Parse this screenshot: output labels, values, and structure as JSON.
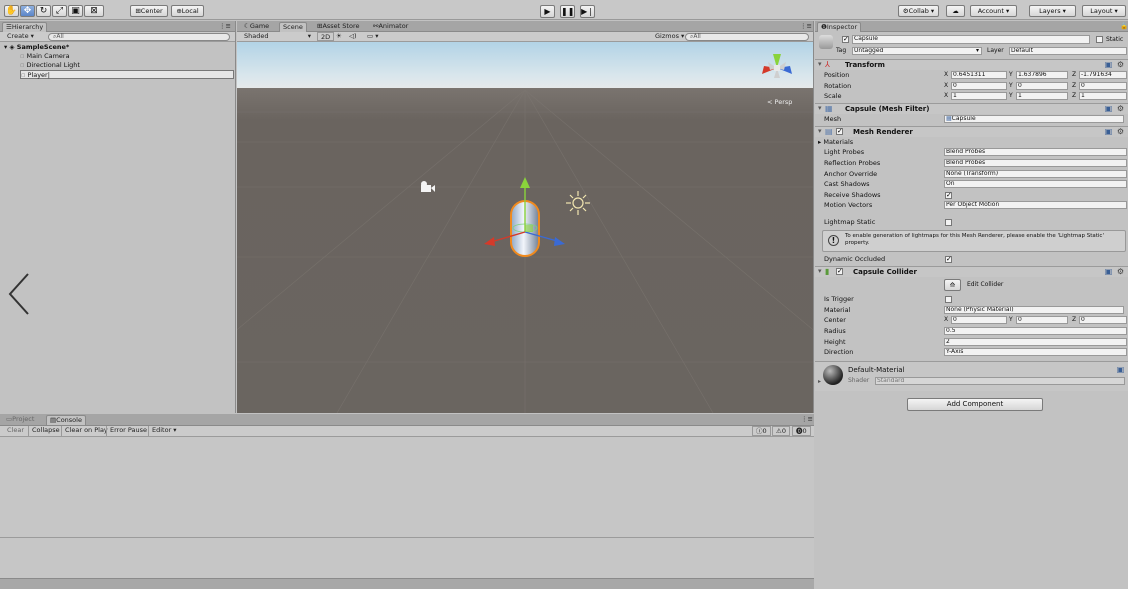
{
  "toolbar": {
    "tools": [
      "hand-tool",
      "move-tool",
      "rotate-tool",
      "scale-tool",
      "rect-tool",
      "transform-tool"
    ],
    "pivot_label": "Center",
    "space_label": "Local",
    "collab_label": "Collab ▾",
    "account_label": "Account ▾",
    "layers_label": "Layers ▾",
    "layout_label": "Layout ▾"
  },
  "hierarchy": {
    "tab_label": "Hierarchy",
    "create_label": "Create ▾",
    "search_placeholder": "All",
    "scene_name": "SampleScene*",
    "items": [
      "Main Camera",
      "Directional Light",
      "Player"
    ]
  },
  "scene": {
    "tabs": [
      "Game",
      "Scene",
      "Asset Store",
      "Animator"
    ],
    "shading": "Shaded",
    "mode_2d": "2D",
    "gizmos_label": "Gizmos ▾",
    "search_placeholder": "All",
    "persp_label": "< Persp"
  },
  "inspector": {
    "tab_label": "Inspector",
    "object_name": "Capsule",
    "static_label": "Static",
    "tag_label": "Tag",
    "tag_value": "Untagged",
    "layer_label": "Layer",
    "layer_value": "Default",
    "transform": {
      "title": "Transform",
      "position_label": "Position",
      "position": {
        "x": "0.6451311",
        "y": "1.637896",
        "z": "-1.791634"
      },
      "rotation_label": "Rotation",
      "rotation": {
        "x": "0",
        "y": "0",
        "z": "0"
      },
      "scale_label": "Scale",
      "scale": {
        "x": "1",
        "y": "1",
        "z": "1"
      }
    },
    "mesh_filter": {
      "title": "Capsule (Mesh Filter)",
      "mesh_label": "Mesh",
      "mesh_value": "Capsule"
    },
    "mesh_renderer": {
      "title": "Mesh Renderer",
      "materials_label": "Materials",
      "light_probes_label": "Light Probes",
      "light_probes_value": "Blend Probes",
      "reflection_probes_label": "Reflection Probes",
      "reflection_probes_value": "Blend Probes",
      "anchor_override_label": "Anchor Override",
      "anchor_override_value": "None (Transform)",
      "cast_shadows_label": "Cast Shadows",
      "cast_shadows_value": "On",
      "receive_shadows_label": "Receive Shadows",
      "motion_vectors_label": "Motion Vectors",
      "motion_vectors_value": "Per Object Motion",
      "lightmap_static_label": "Lightmap Static",
      "info_text": "To enable generation of lightmaps for this Mesh Renderer, please enable the 'Lightmap Static' property.",
      "dynamic_occluded_label": "Dynamic Occluded"
    },
    "capsule_collider": {
      "title": "Capsule Collider",
      "edit_collider_label": "Edit Collider",
      "is_trigger_label": "Is Trigger",
      "material_label": "Material",
      "material_value": "None (Physic Material)",
      "center_label": "Center",
      "center": {
        "x": "0",
        "y": "0",
        "z": "0"
      },
      "radius_label": "Radius",
      "radius_value": "0.5",
      "height_label": "Height",
      "height_value": "2",
      "direction_label": "Direction",
      "direction_value": "Y-Axis"
    },
    "material": {
      "name": "Default-Material",
      "shader_label": "Shader",
      "shader_value": "Standard"
    },
    "add_component_label": "Add Component"
  },
  "console": {
    "tabs": [
      "Project",
      "Console"
    ],
    "buttons": [
      "Clear",
      "Collapse",
      "Clear on Play",
      "Error Pause",
      "Editor ▾"
    ],
    "info_count": "0",
    "warning_count": "0",
    "error_count": "0"
  },
  "colors": {
    "panel": "#c2c2c2",
    "sky_top": "#b8d8e8",
    "ground": "#6b6661",
    "capsule_outline": "#f08a1e"
  }
}
